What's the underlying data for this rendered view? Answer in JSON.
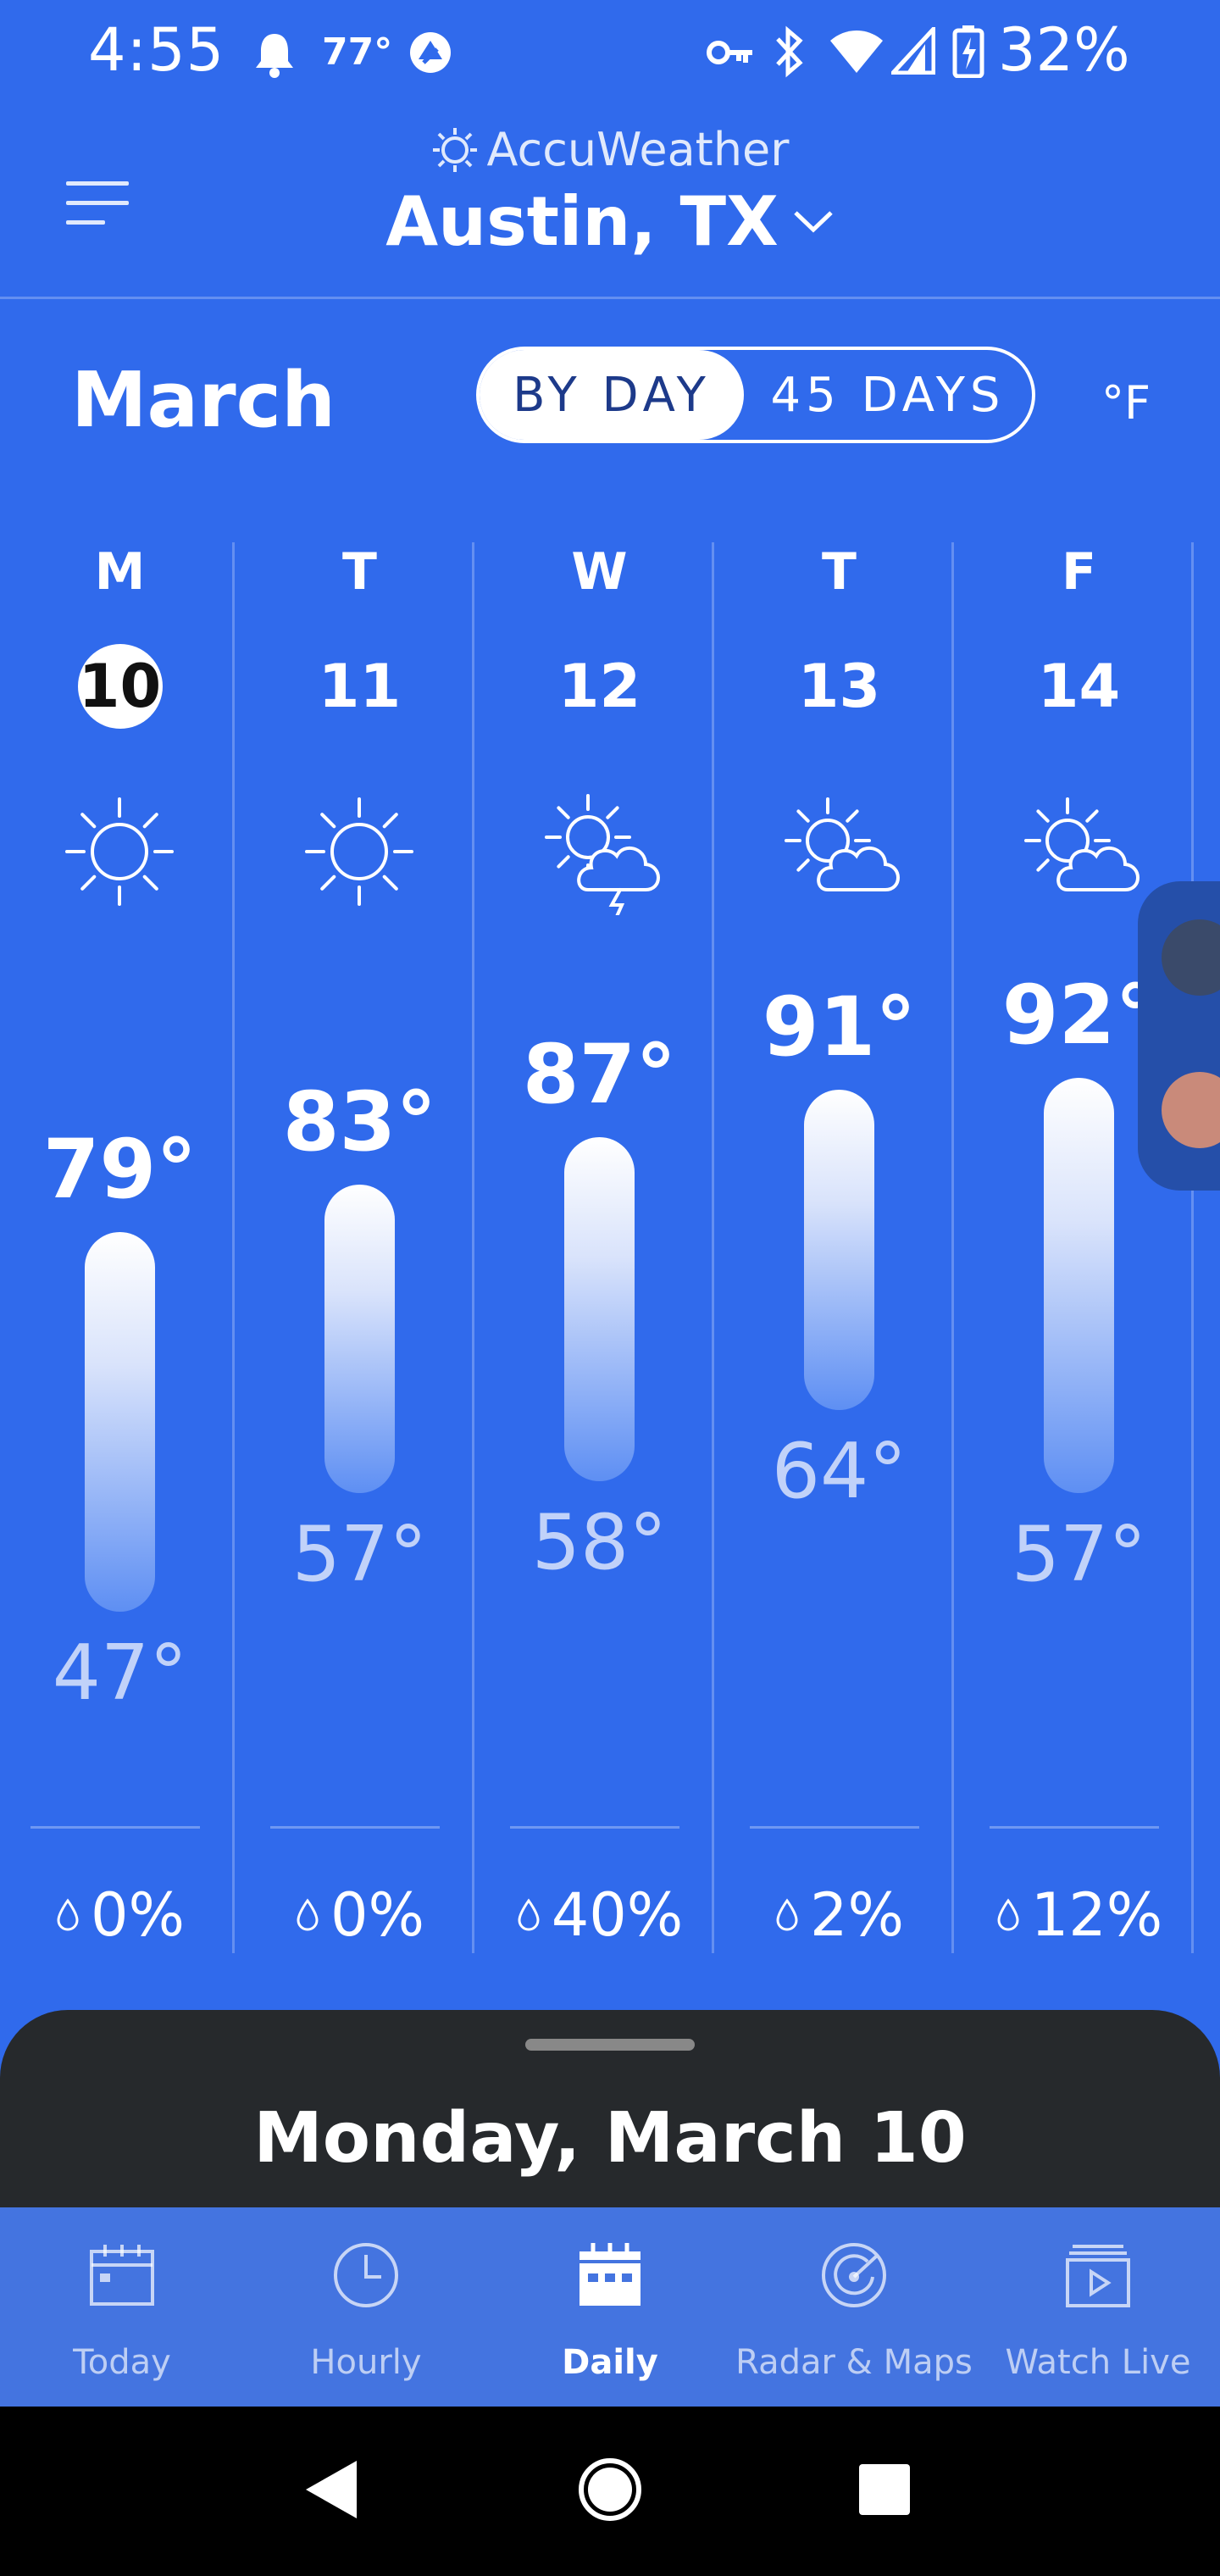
{
  "status_bar": {
    "time": "4:55",
    "temperature": "77°",
    "battery": "32%"
  },
  "header": {
    "brand": "AccuWeather",
    "location": "Austin, TX"
  },
  "controls": {
    "month": "March",
    "toggle_by_day": "BY DAY",
    "toggle_45_days": "45 DAYS",
    "unit": "°F"
  },
  "days": [
    {
      "letter": "M",
      "date": "10",
      "high": "79°",
      "low": "47°",
      "precip": "0%",
      "icon": "sun-icon",
      "selected": true
    },
    {
      "letter": "T",
      "date": "11",
      "high": "83°",
      "low": "57°",
      "precip": "0%",
      "icon": "sun-icon",
      "selected": false
    },
    {
      "letter": "W",
      "date": "12",
      "high": "87°",
      "low": "58°",
      "precip": "40%",
      "icon": "thunderstorm-partly-sunny-icon",
      "selected": false
    },
    {
      "letter": "T",
      "date": "13",
      "high": "91°",
      "low": "64°",
      "precip": "2%",
      "icon": "partly-sunny-icon",
      "selected": false
    },
    {
      "letter": "F",
      "date": "14",
      "high": "92°",
      "low": "57°",
      "precip": "12%",
      "icon": "partly-sunny-icon",
      "selected": false
    }
  ],
  "sheet": {
    "title": "Monday, March 10"
  },
  "bottom_nav": {
    "items": [
      {
        "label": "Today",
        "icon": "calendar-day-icon",
        "active": false
      },
      {
        "label": "Hourly",
        "icon": "clock-icon",
        "active": false
      },
      {
        "label": "Daily",
        "icon": "calendar-grid-icon",
        "active": true
      },
      {
        "label": "Radar & Maps",
        "icon": "radar-icon",
        "active": false
      },
      {
        "label": "Watch Live",
        "icon": "video-icon",
        "active": false
      }
    ]
  },
  "colors": {
    "background": "#306AEC",
    "sheet": "#26292C",
    "bottom_nav": "#4474E0"
  }
}
